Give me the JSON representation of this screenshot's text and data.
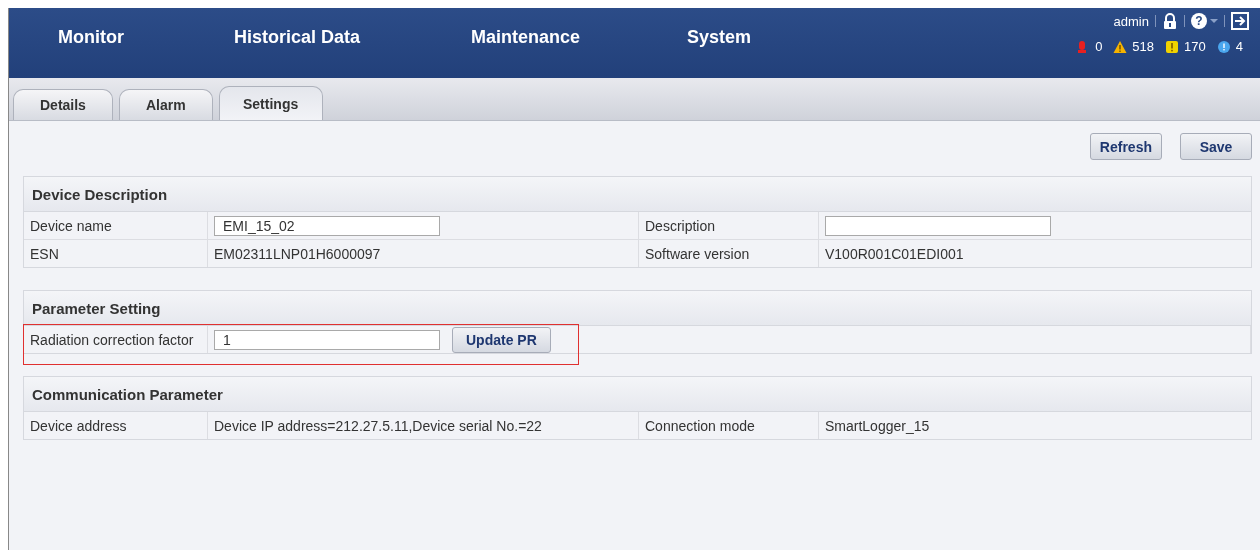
{
  "nav": [
    {
      "label": "Monitor"
    },
    {
      "label": "Historical Data"
    },
    {
      "label": "Maintenance"
    },
    {
      "label": "System"
    }
  ],
  "user": "admin",
  "help_glyph": "?",
  "alarm_counts": [
    {
      "kind": "critical",
      "count": "0"
    },
    {
      "kind": "major",
      "count": "518"
    },
    {
      "kind": "minor",
      "count": "170"
    },
    {
      "kind": "warning",
      "count": "4"
    }
  ],
  "tabs": [
    {
      "label": "Details",
      "selected": false
    },
    {
      "label": "Alarm",
      "selected": false
    },
    {
      "label": "Settings",
      "selected": true
    }
  ],
  "buttons": [
    "Refresh",
    "Save"
  ],
  "sections": [
    {
      "title": "Device Description",
      "rows": [
        {
          "highlighted": false,
          "cells": [
            {
              "kind": "label",
              "text": "Device name"
            },
            {
              "kind": "input",
              "value": "EMI_15_02"
            },
            {
              "kind": "label",
              "text": "Description"
            },
            {
              "kind": "input"
            }
          ]
        },
        {
          "highlighted": false,
          "cells": [
            {
              "kind": "label",
              "text": "ESN"
            },
            {
              "kind": "text",
              "text": "EM02311LNP01H6000097"
            },
            {
              "kind": "label",
              "text": "Software version"
            },
            {
              "kind": "text",
              "text": "V100R001C01EDI001"
            }
          ]
        }
      ]
    },
    {
      "title": "Parameter Setting",
      "rows": [
        {
          "highlighted": true,
          "cells": [
            {
              "kind": "label",
              "text": "Radiation correction factor"
            },
            {
              "kind": "input",
              "value": "1",
              "button": "Update PR"
            }
          ]
        }
      ]
    },
    {
      "title": "Communication Parameter",
      "rows": [
        {
          "highlighted": false,
          "cells": [
            {
              "kind": "label",
              "text": "Device address"
            },
            {
              "kind": "text",
              "text": "Device IP address=212.27.5.11,Device serial No.=22"
            },
            {
              "kind": "label",
              "text": "Connection mode"
            },
            {
              "kind": "text",
              "text": "SmartLogger_15"
            }
          ]
        }
      ]
    }
  ]
}
